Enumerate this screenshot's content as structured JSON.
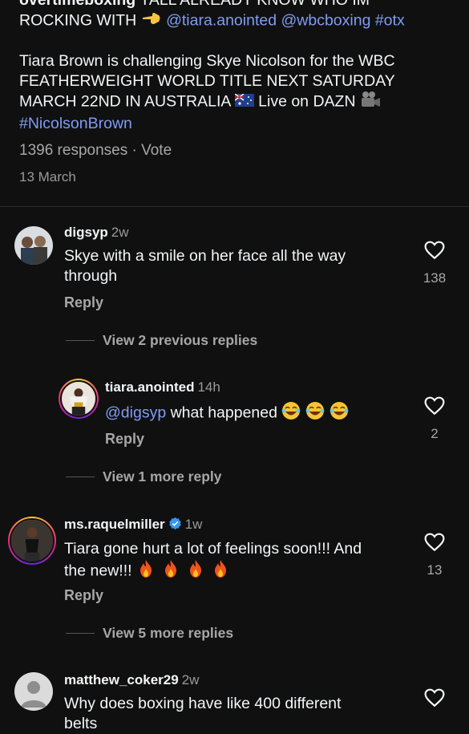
{
  "post": {
    "author": "overtimeboxing",
    "caption_line1_tail": " YALL ALREADY KNOW WHO IM",
    "caption_line2": "ROCKING WITH ",
    "caption_tags": "@tiara.anointed @wbcboxing #otx",
    "caption_body": "Tiara Brown is challenging Skye Nicolson for the WBC FEATHERWEIGHT WORLD TITLE NEXT SATURDAY MARCH 22ND IN AUSTRALIA ",
    "caption_live": " Live on DAZN ",
    "caption_hashtag": "#NicolsonBrown",
    "responses": "1396 responses",
    "vote": "Vote",
    "separator": " · ",
    "date": "13 March"
  },
  "comments": [
    {
      "username": "digsyp",
      "time": "2w",
      "text": "Skye with a smile on her face all the way through",
      "likes": "138",
      "reply_label": "Reply",
      "view_replies": "View 2 previous replies"
    },
    {
      "username": "tiara.anointed",
      "time": "14h",
      "mention": "@digsyp",
      "text": " what happened ",
      "likes": "2",
      "reply_label": "Reply",
      "view_replies": "View 1 more reply"
    },
    {
      "username": "ms.raquelmiller",
      "time": "1w",
      "text_line1": "Tiara gone hurt a lot of feelings soon!!! And",
      "text_line2": "the new!!! ",
      "likes": "13",
      "reply_label": "Reply",
      "view_replies": "View 5 more replies"
    },
    {
      "username": "matthew_coker29",
      "time": "2w",
      "text_line1": "Why does boxing have like 400 different",
      "text_line2": "belts"
    }
  ],
  "colors": {
    "background": "#101010",
    "link": "#7f9cf5",
    "muted": "#a7a7a7",
    "verified": "#3897f0"
  }
}
